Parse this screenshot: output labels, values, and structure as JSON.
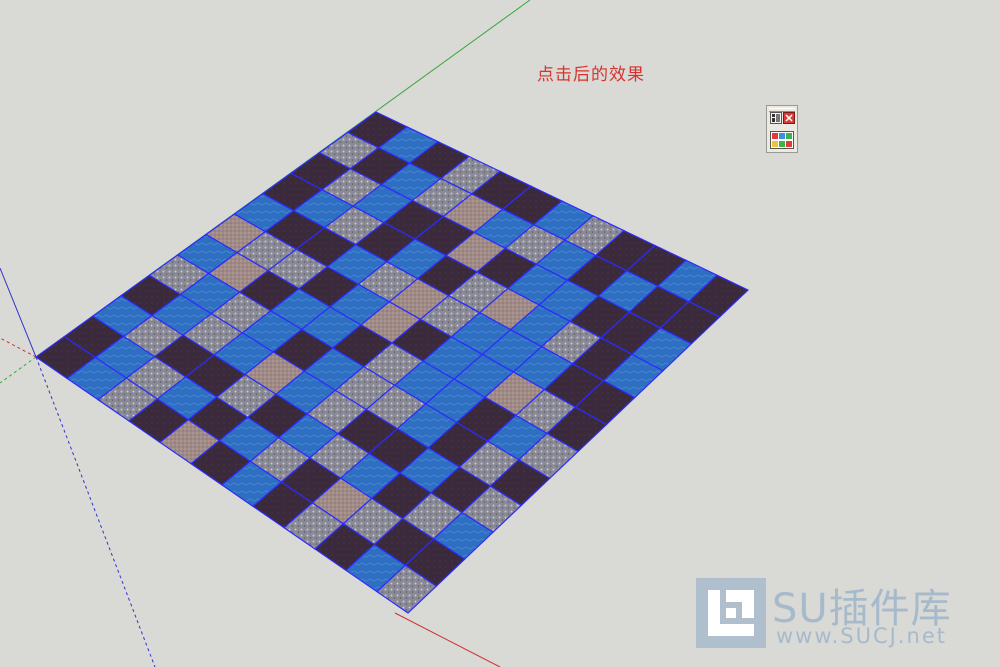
{
  "caption": "点击后的效果",
  "watermark": {
    "title": "SU插件库",
    "url": "www.SUCJ.net"
  },
  "toolbar": {
    "buttons": [
      {
        "name": "plugin-window-icon"
      },
      {
        "name": "close-icon"
      },
      {
        "name": "random-material-tiles-icon"
      }
    ]
  },
  "floor": {
    "rows": 12,
    "cols": 12,
    "grid_line_color": "#2b2bff",
    "materials": {
      "D": {
        "name": "dark-purple",
        "color": "#3a2a3c"
      },
      "B": {
        "name": "blue",
        "color": "#2f6fc2"
      },
      "G": {
        "name": "gray-granite",
        "color": "#8a8a96"
      },
      "P": {
        "name": "pink-beige",
        "color": "#a08a86"
      }
    },
    "pattern": [
      "DBDGDDBGDDBD",
      "GDBGPBGBDBDD",
      "DGBDDPDBBDDB",
      "DBGDBDGPBGDB",
      "BDDBGPGBBBDD",
      "PGGDBPDBBPGD",
      "BPDBBDGBBDBG",
      "GBGBDBGGBDGD",
      "DBGBPBGDDBDG",
      "BGDDGDBGBDGB",
      "DBGBDBGDPGDD",
      "DBGDPDBDGDBG"
    ]
  },
  "axes": {
    "green": "#3aa83a",
    "red": "#cc3333",
    "blue": "#3333cc"
  }
}
